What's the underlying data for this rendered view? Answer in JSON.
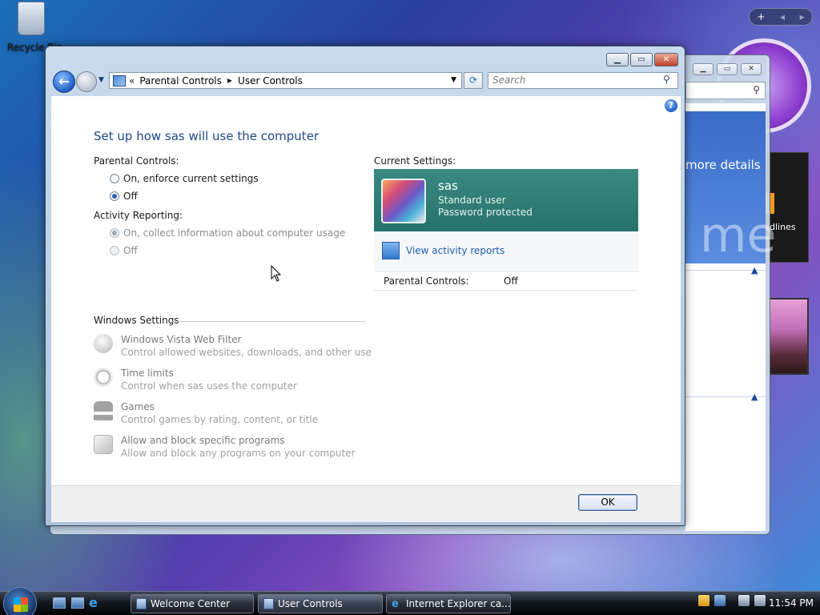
{
  "desktop": {
    "recycle_bin_label": "Recycle Bin"
  },
  "gadgets": {
    "feed_text": "dlines"
  },
  "background_window": {
    "banner_text": "more details",
    "banner_big_text": "me"
  },
  "window": {
    "breadcrumb": {
      "chevron": "«",
      "items": [
        "Parental Controls",
        "User Controls"
      ]
    },
    "search_placeholder": "Search",
    "help_label": "?",
    "title": "Set up how sas will use the computer",
    "parental_controls": {
      "label": "Parental Controls:",
      "options": [
        "On, enforce current settings",
        "Off"
      ],
      "selected": "Off"
    },
    "activity_reporting": {
      "label": "Activity Reporting:",
      "options": [
        "On, collect information about computer usage",
        "Off"
      ],
      "selected": "On, collect information about computer usage",
      "enabled": false
    },
    "windows_settings": {
      "label": "Windows Settings",
      "items": [
        {
          "icon": "globe-icon",
          "title": "Windows Vista Web Filter",
          "desc": "Control allowed websites, downloads, and other use"
        },
        {
          "icon": "stopwatch-icon",
          "title": "Time limits",
          "desc": "Control when sas uses the computer"
        },
        {
          "icon": "trophy-icon",
          "title": "Games",
          "desc": "Control games by rating, content, or title"
        },
        {
          "icon": "program-icon",
          "title": "Allow and block specific programs",
          "desc": "Allow and block any programs on your computer"
        }
      ]
    },
    "current_settings": {
      "label": "Current Settings:",
      "user_name": "sas",
      "user_type": "Standard user",
      "password_status": "Password protected",
      "activity_link": "View activity reports",
      "parental_controls_key": "Parental Controls:",
      "parental_controls_value": "Off"
    },
    "ok_label": "OK"
  },
  "taskbar": {
    "tasks": [
      {
        "label": "Welcome Center",
        "active": false
      },
      {
        "label": "User Controls",
        "active": true
      },
      {
        "label": "Internet Explorer ca...",
        "active": false
      }
    ],
    "clock": "11:54 PM"
  },
  "colors": {
    "title_blue": "#1e4b8a",
    "user_card": "#2f7f77",
    "link_blue": "#1e5fb4"
  }
}
